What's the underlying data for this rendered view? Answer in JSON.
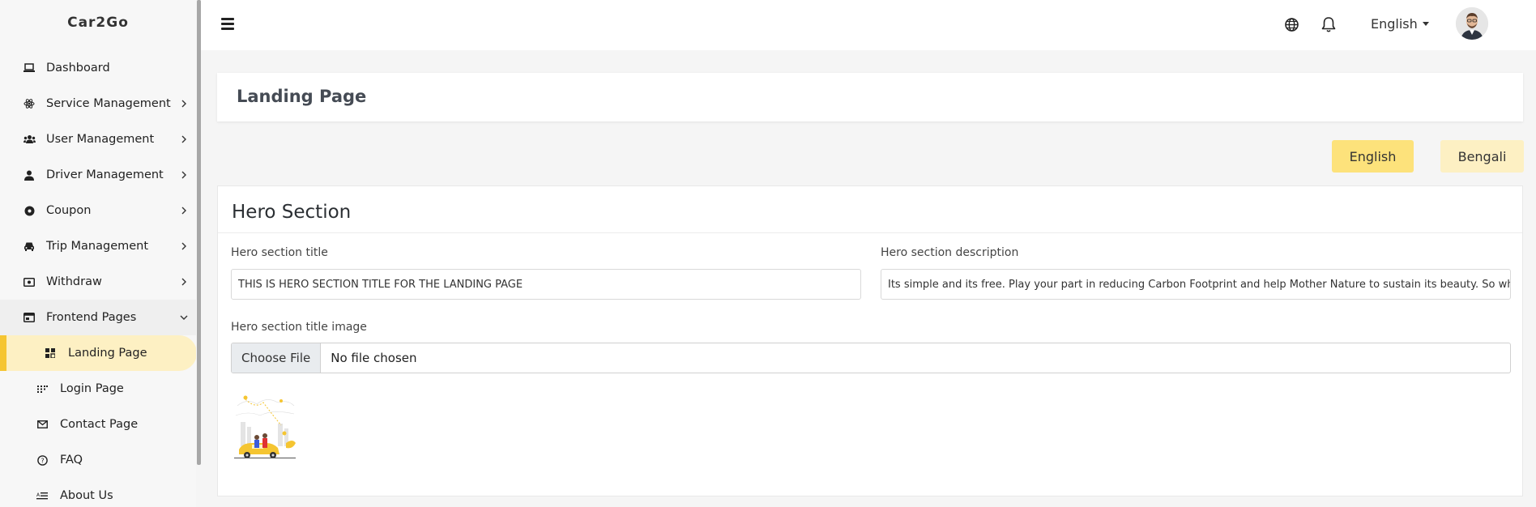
{
  "sidebar": {
    "brand": "Car2Go",
    "items": [
      {
        "label": "Dashboard",
        "icon": "laptop-icon",
        "has_children": false
      },
      {
        "label": "Service Management",
        "icon": "atom-icon",
        "has_children": true
      },
      {
        "label": "User Management",
        "icon": "users-icon",
        "has_children": true
      },
      {
        "label": "Driver Management",
        "icon": "user-icon",
        "has_children": true
      },
      {
        "label": "Coupon",
        "icon": "coupon-icon",
        "has_children": true
      },
      {
        "label": "Trip Management",
        "icon": "car-icon",
        "has_children": true
      },
      {
        "label": "Withdraw",
        "icon": "money-icon",
        "has_children": true
      },
      {
        "label": "Frontend Pages",
        "icon": "window-icon",
        "has_children": true,
        "expanded": true
      }
    ],
    "sub_items": [
      {
        "label": "Landing Page",
        "icon": "grid-icon",
        "active": true
      },
      {
        "label": "Login Page",
        "icon": "dots-grid-icon"
      },
      {
        "label": "Contact Page",
        "icon": "envelope-icon"
      },
      {
        "label": "FAQ",
        "icon": "question-icon"
      },
      {
        "label": "About Us",
        "icon": "list-icon"
      }
    ]
  },
  "topbar": {
    "language": "English"
  },
  "page": {
    "title": "Landing Page"
  },
  "language_tabs": {
    "english": "English",
    "bengali": "Bengali"
  },
  "hero": {
    "heading": "Hero Section",
    "title_label": "Hero section title",
    "title_value": "THIS IS HERO SECTION TITLE FOR THE LANDING PAGE",
    "description_label": "Hero section description",
    "description_value": "Its simple and its free. Play your part in reducing Carbon Footprint and help Mother Nature to sustain its beauty. So what are you waiting for",
    "image_label": "Hero section title image",
    "file_button": "Choose File",
    "file_status": "No file chosen"
  },
  "colors": {
    "accent": "#f5c531",
    "accent_light": "#fdf0c3",
    "button_active": "#fde27b"
  }
}
